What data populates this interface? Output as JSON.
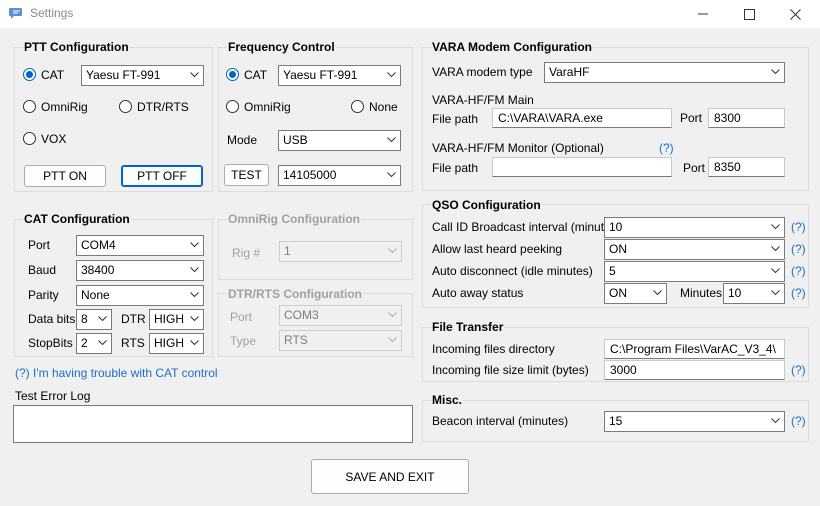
{
  "window": {
    "title": "Settings",
    "minimize": "—",
    "maximize": "☐",
    "close": "✕"
  },
  "ptt": {
    "title": "PTT Configuration",
    "cat_label": "CAT",
    "cat_value": "Yaesu FT-991",
    "omnirig_label": "OmniRig",
    "dtrrts_label": "DTR/RTS",
    "vox_label": "VOX",
    "ptt_on": "PTT ON",
    "ptt_off": "PTT OFF"
  },
  "freq": {
    "title": "Frequency Control",
    "cat_label": "CAT",
    "cat_value": "Yaesu FT-991",
    "omnirig_label": "OmniRig",
    "none_label": "None",
    "mode_label": "Mode",
    "mode_value": "USB",
    "test_label": "TEST",
    "freq_value": "14105000"
  },
  "cat": {
    "title": "CAT Configuration",
    "port_label": "Port",
    "port_value": "COM4",
    "baud_label": "Baud",
    "baud_value": "38400",
    "parity_label": "Parity",
    "parity_value": "None",
    "databits_label": "Data bits",
    "databits_value": "8",
    "dtr_label": "DTR",
    "dtr_value": "HIGH",
    "stopbits_label": "StopBits",
    "stopbits_value": "2",
    "rts_label": "RTS",
    "rts_value": "HIGH",
    "help_link": "(?) I'm having trouble with CAT control"
  },
  "omnirig": {
    "title": "OmniRig Configuration",
    "rig_label": "Rig #",
    "rig_value": "1"
  },
  "dtrrts": {
    "title": "DTR/RTS Configuration",
    "port_label": "Port",
    "port_value": "COM3",
    "type_label": "Type",
    "type_value": "RTS"
  },
  "errorlog": {
    "label": "Test Error Log",
    "value": ""
  },
  "vara": {
    "title": "VARA Modem Configuration",
    "type_label": "VARA modem type",
    "type_value": "VaraHF",
    "main_label": "VARA-HF/FM Main",
    "main_path_label": "File path",
    "main_path_value": "C:\\VARA\\VARA.exe",
    "main_port_label": "Port",
    "main_port_value": "8300",
    "monitor_label": "VARA-HF/FM Monitor (Optional)",
    "monitor_help": "(?)",
    "mon_path_label": "File path",
    "mon_path_value": "",
    "mon_port_label": "Port",
    "mon_port_value": "8350"
  },
  "qso": {
    "title": "QSO Configuration",
    "callid_label": "Call ID Broadcast interval (minutes)",
    "callid_value": "10",
    "lastheard_label": "Allow last heard peeking",
    "lastheard_value": "ON",
    "autodisc_label": "Auto disconnect (idle minutes)",
    "autodisc_value": "5",
    "away_label": "Auto away status",
    "away_value": "ON",
    "minutes_label": "Minutes",
    "minutes_value": "10",
    "help": "(?)"
  },
  "transfer": {
    "title": "File Transfer",
    "dir_label": "Incoming files directory",
    "dir_value": "C:\\Program Files\\VarAC_V3_4\\",
    "limit_label": "Incoming file size limit (bytes)",
    "limit_value": "3000",
    "help": "(?)"
  },
  "misc": {
    "title": "Misc.",
    "beacon_label": "Beacon interval (minutes)",
    "beacon_value": "15",
    "help": "(?)"
  },
  "save_label": "SAVE AND EXIT"
}
